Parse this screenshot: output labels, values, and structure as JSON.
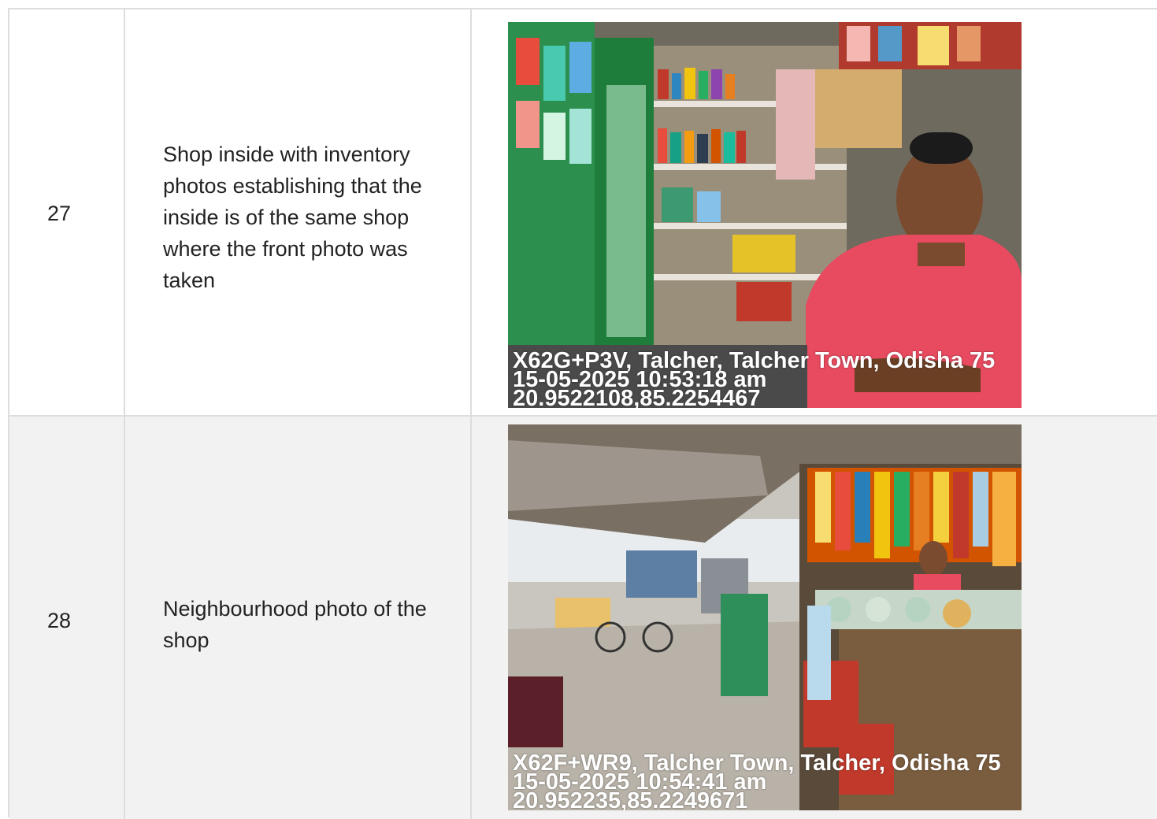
{
  "rows": [
    {
      "number": "27",
      "description": "Shop inside with inventory photos establishing that the inside is of the same shop where the front photo was taken",
      "photo": {
        "subject": "shop-interior-shopkeeper",
        "stamp_address": "X62G+P3V, Talcher, Talcher Town, Odisha 75",
        "stamp_datetime": "15-05-2025 10:53:18 am",
        "stamp_coords": "20.9522108,85.2254467"
      }
    },
    {
      "number": "28",
      "description": "Neighbourhood photo of the shop",
      "photo": {
        "subject": "shop-neighbourhood",
        "stamp_address": "X62F+WR9, Talcher Town, Talcher, Odisha 75",
        "stamp_datetime": "15-05-2025 10:54:41 am",
        "stamp_coords": "20.952235,85.2249671"
      }
    }
  ],
  "colors": {
    "border": "#dddddd",
    "row_alt_bg": "#f2f2f2",
    "text": "#222222",
    "stamp_text": "#ffffff"
  }
}
